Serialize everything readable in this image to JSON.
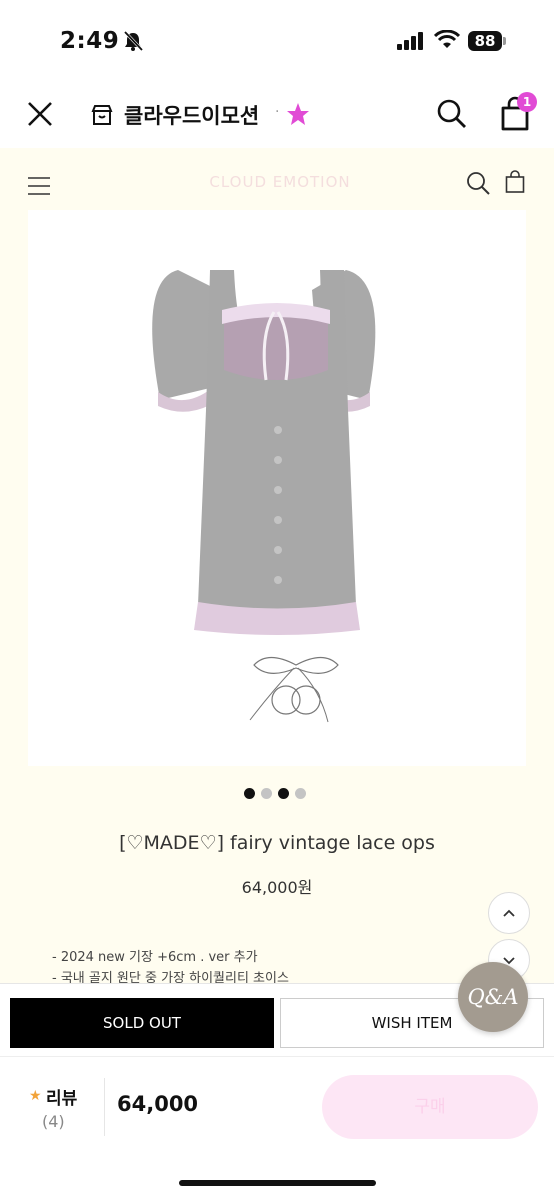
{
  "status_bar": {
    "time": "2:49",
    "battery": "88"
  },
  "header": {
    "store_name": "클라우드이모션",
    "separator": "·",
    "cart_count": "1"
  },
  "shop": {
    "logo_text": "CLOUD EMOTION"
  },
  "carousel": {
    "total": 4,
    "active": [
      0,
      2
    ]
  },
  "product": {
    "title": "[♡MADE♡] fairy vintage lace ops",
    "price": "64,000원",
    "description": [
      "- 2024 new 기장 +6cm . ver 추가",
      "- 국내 골지 원단 중 가장 하이퀄리티 초이스"
    ]
  },
  "actions": {
    "sold_out": "SOLD OUT",
    "wish": "WISH ITEM",
    "qa": "Q&A"
  },
  "bottom_bar": {
    "review_label": "리뷰",
    "review_count": "(4)",
    "price": "64,000",
    "buy_label": "구매"
  },
  "colors": {
    "accent": "#e14bd5",
    "background": "#fffdf0",
    "qa_button": "#a39b90",
    "review_star": "#f2a33a"
  }
}
